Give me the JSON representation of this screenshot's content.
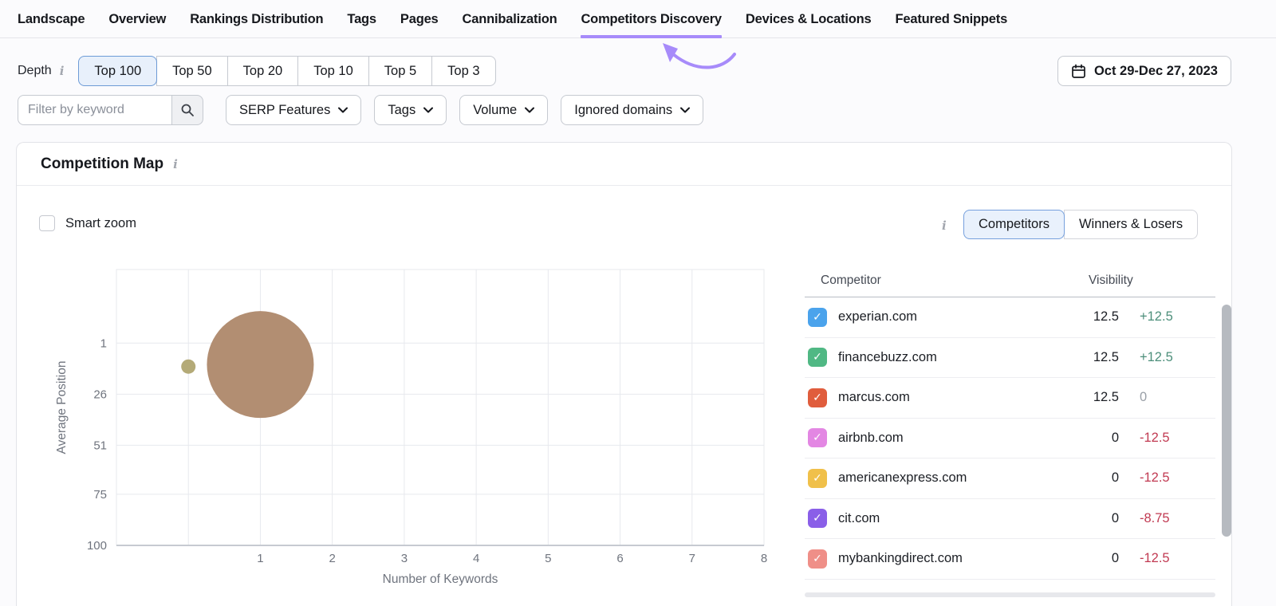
{
  "nav": {
    "items": [
      {
        "label": "Landscape"
      },
      {
        "label": "Overview"
      },
      {
        "label": "Rankings Distribution"
      },
      {
        "label": "Tags"
      },
      {
        "label": "Pages"
      },
      {
        "label": "Cannibalization"
      },
      {
        "label": "Competitors Discovery"
      },
      {
        "label": "Devices & Locations"
      },
      {
        "label": "Featured Snippets"
      }
    ],
    "active_item": "Competitors Discovery"
  },
  "controls": {
    "depth_label": "Depth",
    "depth_options": [
      {
        "label": "Top 100"
      },
      {
        "label": "Top 50"
      },
      {
        "label": "Top 20"
      },
      {
        "label": "Top 10"
      },
      {
        "label": "Top 5"
      },
      {
        "label": "Top 3"
      }
    ],
    "depth_selected": "Top 100",
    "date_range": "Oct 29-Dec 27, 2023",
    "keyword_filter_placeholder": "Filter by keyword",
    "dropdowns": [
      {
        "label": "SERP Features"
      },
      {
        "label": "Tags"
      },
      {
        "label": "Volume"
      },
      {
        "label": "Ignored domains"
      }
    ]
  },
  "card": {
    "title": "Competition Map",
    "smart_zoom_label": "Smart zoom",
    "smart_zoom_checked": false,
    "view_toggle": {
      "options": [
        {
          "label": "Competitors"
        },
        {
          "label": "Winners & Losers"
        }
      ],
      "selected": "Competitors"
    }
  },
  "chart_data": {
    "type": "scatter",
    "subtype": "bubble",
    "title": "Competition Map",
    "xlabel": "Number of Keywords",
    "ylabel": "Average Position",
    "x_ticks": [
      1,
      2,
      3,
      4,
      5,
      6,
      7,
      8
    ],
    "x_gridline_values": [
      0,
      1,
      2,
      3,
      4,
      5,
      6,
      7,
      8
    ],
    "y_ticks": [
      1,
      26,
      51,
      75,
      100
    ],
    "y_axis_inverted": true,
    "x_range": [
      -1,
      8
    ],
    "y_range": [
      -35,
      100
    ],
    "grid": true,
    "legend": false,
    "bubbles": [
      {
        "x": 1,
        "y": 11.5,
        "radius_px": 67,
        "color": "#b28e72"
      },
      {
        "x": 0,
        "y": 12.5,
        "radius_px": 9,
        "color": "#b4aa77"
      }
    ]
  },
  "table": {
    "columns": [
      {
        "label": "Competitor"
      },
      {
        "label": "Visibility"
      }
    ],
    "rows": [
      {
        "domain": "experian.com",
        "checkbox_color": "#4ba3ec",
        "visibility": "12.5",
        "change": "+12.5",
        "trend": "pos"
      },
      {
        "domain": "financebuzz.com",
        "checkbox_color": "#50b884",
        "visibility": "12.5",
        "change": "+12.5",
        "trend": "pos"
      },
      {
        "domain": "marcus.com",
        "checkbox_color": "#e05d3d",
        "visibility": "12.5",
        "change": "0",
        "trend": "flat"
      },
      {
        "domain": "airbnb.com",
        "checkbox_color": "#e387e3",
        "visibility": "0",
        "change": "-12.5",
        "trend": "neg"
      },
      {
        "domain": "americanexpress.com",
        "checkbox_color": "#f0c04a",
        "visibility": "0",
        "change": "-12.5",
        "trend": "neg"
      },
      {
        "domain": "cit.com",
        "checkbox_color": "#8a5fe8",
        "visibility": "0",
        "change": "-8.75",
        "trend": "neg"
      },
      {
        "domain": "mybankingdirect.com",
        "checkbox_color": "#ef8f88",
        "visibility": "0",
        "change": "-12.5",
        "trend": "neg"
      }
    ]
  },
  "colors": {
    "accent_purple": "#a78bfa",
    "selected_blue_border": "#6d9bd6",
    "selected_blue_bg": "#e8f0fb",
    "positive": "#4d8f7b",
    "negative": "#c13a52",
    "neutral": "#9aa0a8",
    "bubble_large": "#b28e72",
    "bubble_small": "#b4aa77"
  }
}
